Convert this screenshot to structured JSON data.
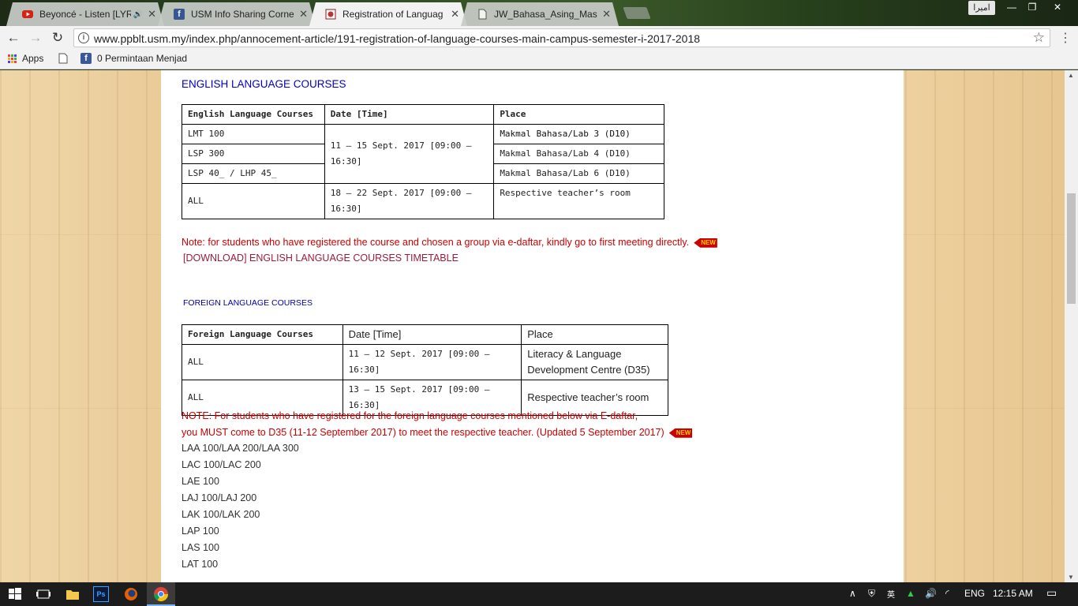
{
  "browser": {
    "tabs": [
      {
        "title": "Beyoncé - Listen [LYRI",
        "icon": "youtube-icon",
        "audio": true
      },
      {
        "title": "USM Info Sharing Corner",
        "icon": "facebook-icon"
      },
      {
        "title": "Registration of Languag",
        "icon": "usm-crest-icon",
        "active": true
      },
      {
        "title": "JW_Bahasa_Asing_Maste",
        "icon": "document-icon"
      }
    ],
    "profile_name": "اميرا",
    "url": "www.ppblt.usm.my/index.php/annocement-article/191-registration-of-language-courses-main-campus-semester-i-2017-2018",
    "bookmarks": [
      {
        "label": "Apps",
        "icon": "apps-grid-icon"
      },
      {
        "label": "",
        "icon": "page-icon"
      },
      {
        "label": "0 Permintaan Menjad",
        "icon": "facebook-icon"
      }
    ]
  },
  "page": {
    "english_heading": "ENGLISH LANGUAGE COURSES",
    "english_table": {
      "headers": [
        "English Language Courses",
        "Date  [Time]",
        "Place"
      ],
      "rows": [
        {
          "course": "LMT 100",
          "date": "11 – 15 Sept. 2017  [09:00 – 16:30]",
          "place": "Makmal Bahasa/Lab 3 (D10)"
        },
        {
          "course": "LSP 300",
          "place": "Makmal Bahasa/Lab 4 (D10)"
        },
        {
          "course": "LSP 40_ / LHP 45_",
          "place": "Makmal Bahasa/Lab 6 (D10)"
        },
        {
          "course": "ALL",
          "date": "18 – 22 Sept. 2017 [09:00 – 16:30]",
          "place": "Respective teacher’s room"
        }
      ]
    },
    "english_note": "Note: for students who have registered the course and chosen a group via e-daftar, kindly go to first meeting directly.",
    "new_badge": "NEW",
    "download_link": "[DOWNLOAD] ENGLISH LANGUAGE COURSES TIMETABLE",
    "foreign_heading": "FOREIGN LANGUAGE COURSES",
    "foreign_table": {
      "headers": [
        "Foreign Language Courses",
        "Date  [Time]",
        "Place"
      ],
      "rows": [
        {
          "course": "ALL",
          "date": "11 – 12 Sept. 2017 [09:00 – 16:30]",
          "place": "Literacy & Language Development Centre (D35)"
        },
        {
          "course": "ALL",
          "date": "13 – 15 Sept. 2017 [09:00 – 16:30]",
          "place": "Respective teacher’s room"
        }
      ]
    },
    "foreign_note_line1": "NOTE:  For students who have registered for the foreign language courses mentioned below via E-daftar,",
    "foreign_note_line2": "you MUST come to D35 (11-12 September 2017) to meet the respective teacher. (Updated 5 September 2017)",
    "course_codes": [
      "LAA 100/LAA 200/LAA 300",
      "LAC 100/LAC 200",
      "LAE 100",
      "LAJ 100/LAJ 200",
      "LAK 100/LAK 200",
      "LAP 100",
      "LAS 100",
      "LAT 100"
    ]
  },
  "taskbar": {
    "language": "ENG",
    "time": "12:15 AM"
  }
}
